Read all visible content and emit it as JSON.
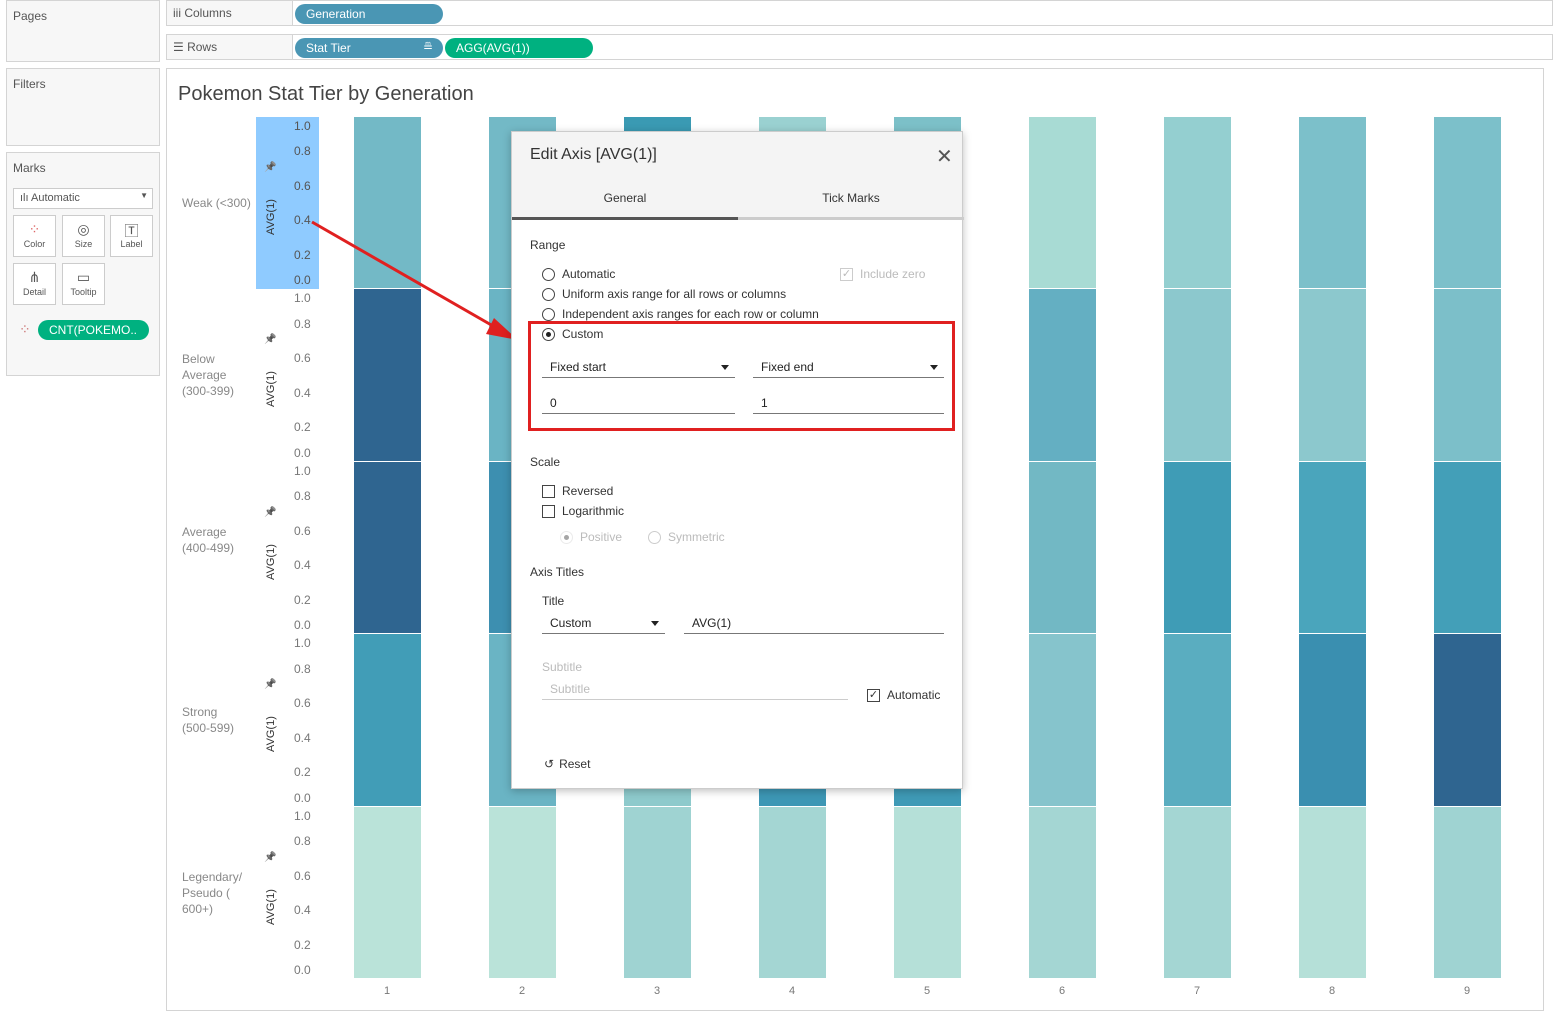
{
  "panels": {
    "pages": "Pages",
    "filters": "Filters",
    "marks": "Marks"
  },
  "marks": {
    "type": "Automatic",
    "buttons": [
      "Color",
      "Size",
      "Label",
      "Detail",
      "Tooltip"
    ],
    "pill": "CNT(POKEMO.."
  },
  "shelves": {
    "columns_label": "Columns",
    "columns_pills": [
      "Generation"
    ],
    "rows_label": "Rows",
    "rows_pills": [
      "Stat Tier",
      "AGG(AVG(1))"
    ]
  },
  "viz": {
    "title": "Pokemon Stat Tier by Generation",
    "axis_title": "AVG(1)",
    "ticks": [
      "1.0",
      "0.8",
      "0.6",
      "0.4",
      "0.2",
      "0.0"
    ],
    "tick_values": [
      1.0,
      0.8,
      0.6,
      0.4,
      0.2,
      0.0
    ],
    "rows": [
      {
        "label": "Weak (<300)",
        "colors": [
          "#73b9c6",
          "#73b9c6",
          "#3a9ab3",
          "#9ad1d1",
          "#7cc0c8",
          "#a8dbd4",
          "#94cfd0",
          "#7cc0ca",
          "#7cc0ca"
        ]
      },
      {
        "label": "Below Average (300-399)",
        "colors": [
          "#2f6590",
          "#6ab4c4",
          "#5aadc0",
          "#8ecacc",
          "#7cc0c8",
          "#64afc2",
          "#8cc8cd",
          "#8cc8cd",
          "#7cbfc9"
        ]
      },
      {
        "label": "Average (400-499)",
        "colors": [
          "#2f6590",
          "#3d8fb0",
          "#4aa5bc",
          "#6ab4c4",
          "#5aadc0",
          "#72b8c4",
          "#3f9cb6",
          "#4aa5bc",
          "#439fb8"
        ]
      },
      {
        "label": "Strong (500-599)",
        "colors": [
          "#419db7",
          "#6ab4c4",
          "#8ecacc",
          "#3d97b5",
          "#3f9ab6",
          "#86c4cc",
          "#5aadc0",
          "#3a8fb0",
          "#2f6590"
        ]
      },
      {
        "label": "Legendary/ Pseudo ( 600+)",
        "colors": [
          "#bae3d9",
          "#bae3d9",
          "#9fd3d2",
          "#a4d6d3",
          "#b5e0d8",
          "#a4d6d3",
          "#a4d6d3",
          "#b5e0d8",
          "#9fd3d2"
        ]
      }
    ],
    "generations": [
      "1",
      "2",
      "3",
      "4",
      "5",
      "6",
      "7",
      "8",
      "9"
    ]
  },
  "dialog": {
    "title": "Edit Axis [AVG(1)]",
    "tabs": [
      "General",
      "Tick Marks"
    ],
    "range": "Range",
    "range_options": [
      "Automatic",
      "Uniform axis range for all rows or columns",
      "Independent axis ranges for each row or column",
      "Custom"
    ],
    "include_zero": "Include zero",
    "start_mode": "Fixed start",
    "end_mode": "Fixed end",
    "start_value": "0",
    "end_value": "1",
    "scale": "Scale",
    "reversed": "Reversed",
    "logarithmic": "Logarithmic",
    "positive": "Positive",
    "symmetric": "Symmetric",
    "axis_titles": "Axis Titles",
    "title_label": "Title",
    "title_mode": "Custom",
    "title_value": "AVG(1)",
    "subtitle_label": "Subtitle",
    "subtitle_placeholder": "Subtitle",
    "automatic": "Automatic",
    "reset": "Reset"
  },
  "colors": {
    "pill_blue": "#4a96b4",
    "pill_green": "#00b180",
    "highlight": "#e02020",
    "axis_select": "#8fcbff"
  }
}
